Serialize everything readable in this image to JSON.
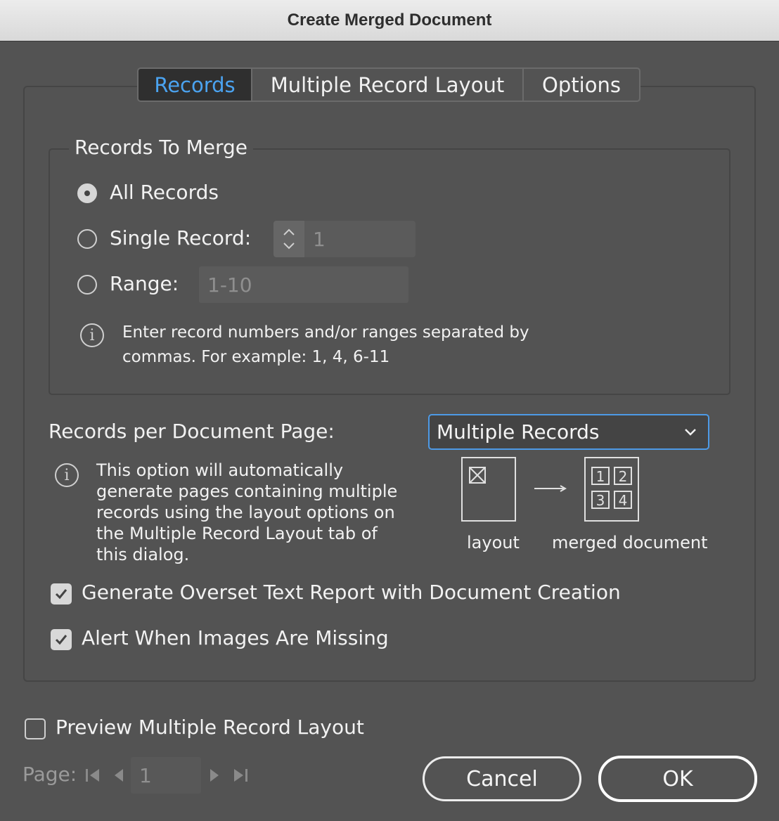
{
  "window": {
    "title": "Create Merged Document"
  },
  "tabs": [
    {
      "label": "Records",
      "active": true
    },
    {
      "label": "Multiple Record Layout",
      "active": false
    },
    {
      "label": "Options",
      "active": false
    }
  ],
  "records_group": {
    "title": "Records To Merge",
    "all_records_label": "All Records",
    "single_record_label": "Single Record:",
    "single_record_value": "1",
    "range_label": "Range:",
    "range_placeholder": "1-10",
    "info_line1": "Enter record numbers and/or ranges separated by",
    "info_line2": "commas. For example: 1, 4, 6-11",
    "selected": "All Records"
  },
  "per_page": {
    "label": "Records per Document Page:",
    "selected": "Multiple Records",
    "info_lines": [
      "This option will automatically",
      "generate pages containing multiple",
      "records using the layout options on",
      "the Multiple Record Layout tab of",
      "this dialog."
    ],
    "diagram": {
      "layout_caption": "layout",
      "merged_caption": "merged document",
      "cells": [
        "1",
        "2",
        "3",
        "4"
      ]
    }
  },
  "checkboxes": {
    "overset_label": "Generate Overset Text Report with Document Creation",
    "overset_checked": true,
    "images_label": "Alert When Images Are Missing",
    "images_checked": true,
    "preview_label": "Preview Multiple Record Layout",
    "preview_checked": false
  },
  "pager": {
    "label": "Page:",
    "value": "1"
  },
  "buttons": {
    "cancel": "Cancel",
    "ok": "OK"
  },
  "colors": {
    "accent": "#4d9ae6",
    "active_tab_text": "#4ba3f0",
    "background": "#535353"
  }
}
